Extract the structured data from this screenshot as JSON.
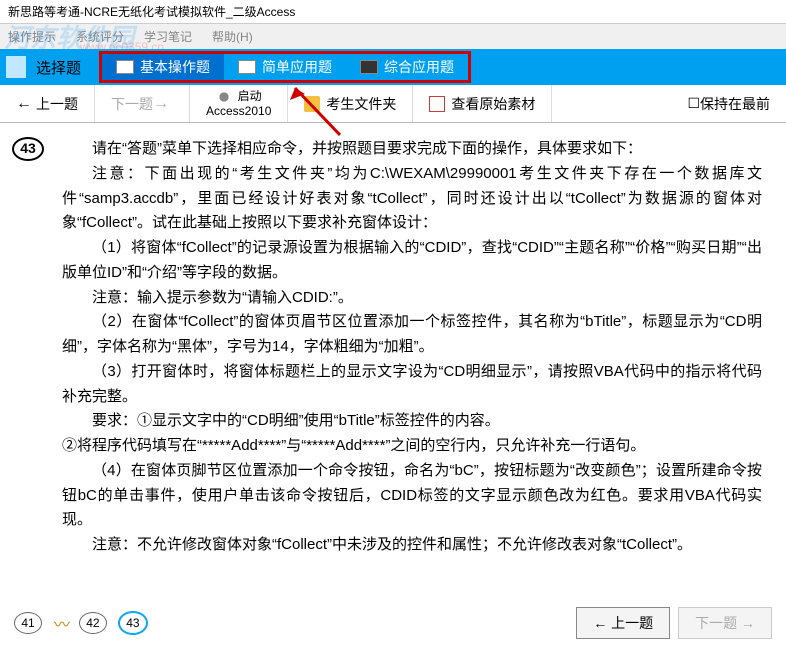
{
  "window": {
    "title": "新思路等考通-NCRE无纸化考试模拟软件_二级Access"
  },
  "watermark": {
    "main": "河东软件园",
    "url": "www.pc0359.cn"
  },
  "menu": {
    "opHint": "操作提示",
    "sysScore": "系统评分",
    "notes": "学习笔记",
    "help": "帮助(H)"
  },
  "bluebar": {
    "chooseQ": "选择题",
    "tabs": [
      {
        "label": "基本操作题",
        "active": true
      },
      {
        "label": "简单应用题",
        "active": false
      },
      {
        "label": "综合应用题",
        "active": false
      }
    ]
  },
  "toolbar": {
    "prev": "上一题",
    "next": "下一题",
    "launch_l1": "启动",
    "launch_l2": "Access2010",
    "stuFolder": "考生文件夹",
    "viewRaw": "查看原始素材",
    "keepFront": "保持在最前"
  },
  "question": {
    "number": "43",
    "p1": "请在“答题”菜单下选择相应命令，并按照题目要求完成下面的操作，具体要求如下：",
    "p2": "注意：下面出现的“考生文件夹”均为C:\\WEXAM\\29990001考生文件夹下存在一个数据库文件“samp3.accdb”，里面已经设计好表对象“tCollect”，同时还设计出以“tCollect”为数据源的窗体对象“fCollect”。试在此基础上按照以下要求补充窗体设计：",
    "p3": "（1）将窗体“fCollect”的记录源设置为根据输入的“CDID”，查找“CDID”“主题名称”“价格”“购买日期”“出版单位ID”和“介绍”等字段的数据。",
    "p4": "注意：输入提示参数为“请输入CDID:”。",
    "p5": "（2）在窗体“fCollect”的窗体页眉节区位置添加一个标签控件，其名称为“bTitle”，标题显示为“CD明细”，字体名称为“黑体”，字号为14，字体粗细为“加粗”。",
    "p6": "（3）打开窗体时，将窗体标题栏上的显示文字设为“CD明细显示”，请按照VBA代码中的指示将代码补充完整。",
    "p7": "要求：①显示文字中的“CD明细”使用“bTitle”标签控件的内容。",
    "p8": "②将程序代码填写在“*****Add****”与“*****Add****”之间的空行内，只允许补充一行语句。",
    "p9": "（4）在窗体页脚节区位置添加一个命令按钮，命名为“bC”，按钮标题为“改变颜色”；设置所建命令按钮bC的单击事件，使用户单击该命令按钮后，CDID标签的文字显示颜色改为红色。要求用VBA代码实现。",
    "p10": "注意：不允许修改窗体对象“fCollect”中未涉及的控件和属性；不允许修改表对象“tCollect”。"
  },
  "bottom": {
    "n41": "41",
    "n42": "42",
    "n43": "43",
    "prev": "上一题",
    "next": "下一题"
  }
}
